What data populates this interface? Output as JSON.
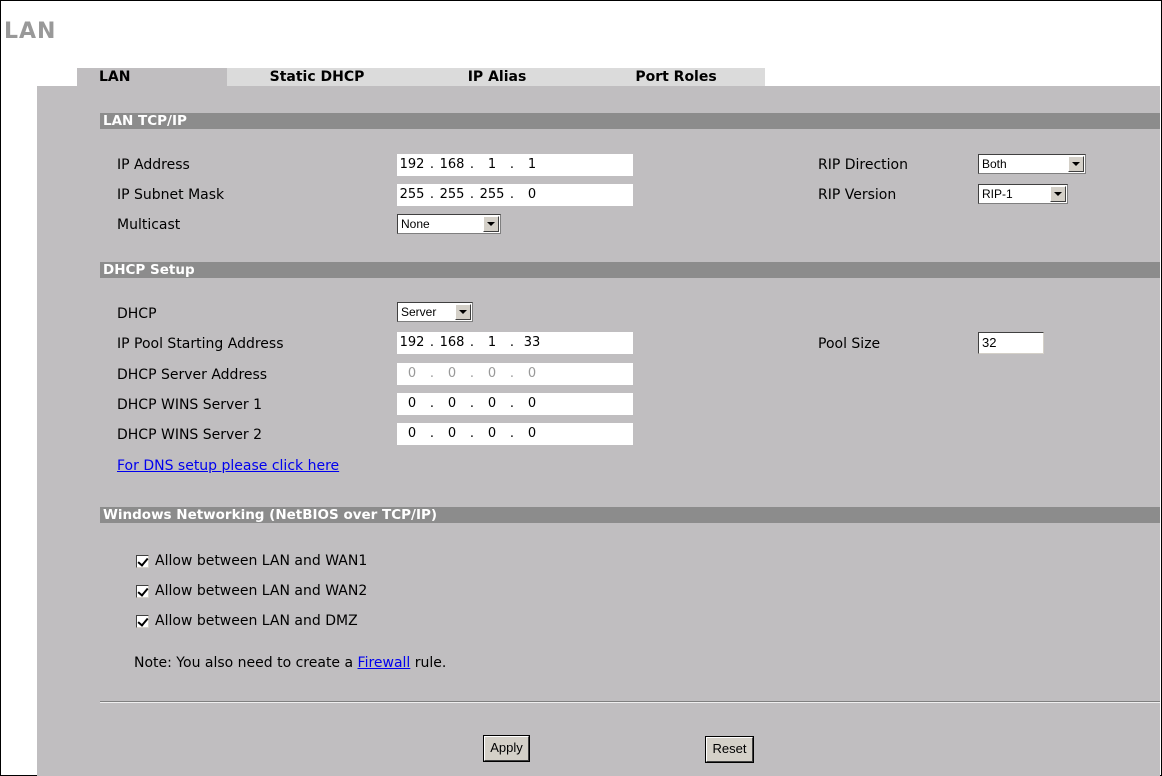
{
  "page": {
    "title": "LAN"
  },
  "tabs": [
    {
      "label": "LAN",
      "active": true
    },
    {
      "label": "Static DHCP",
      "active": false
    },
    {
      "label": "IP Alias",
      "active": false
    },
    {
      "label": "Port Roles",
      "active": false
    }
  ],
  "lan_tcpip": {
    "header": "LAN TCP/IP",
    "ip_address": {
      "label": "IP Address",
      "octets": [
        "192",
        "168",
        "1",
        "1"
      ]
    },
    "subnet_mask": {
      "label": "IP Subnet Mask",
      "octets": [
        "255",
        "255",
        "255",
        "0"
      ]
    },
    "multicast": {
      "label": "Multicast",
      "value": "None"
    },
    "rip_direction": {
      "label": "RIP Direction",
      "value": "Both"
    },
    "rip_version": {
      "label": "RIP Version",
      "value": "RIP-1"
    }
  },
  "dhcp_setup": {
    "header": "DHCP Setup",
    "dhcp": {
      "label": "DHCP",
      "value": "Server"
    },
    "pool_start": {
      "label": "IP Pool Starting Address",
      "octets": [
        "192",
        "168",
        "1",
        "33"
      ]
    },
    "pool_size": {
      "label": "Pool Size",
      "value": "32"
    },
    "server_address": {
      "label": "DHCP Server Address",
      "octets": [
        "0",
        "0",
        "0",
        "0"
      ]
    },
    "wins1": {
      "label": "DHCP WINS Server 1",
      "octets": [
        "0",
        "0",
        "0",
        "0"
      ]
    },
    "wins2": {
      "label": "DHCP WINS Server 2",
      "octets": [
        "0",
        "0",
        "0",
        "0"
      ]
    },
    "dns_link": "For DNS setup please click here"
  },
  "netbios": {
    "header": "Windows Networking (NetBIOS over TCP/IP)",
    "items": [
      {
        "label": "Allow between LAN and WAN1",
        "checked": true
      },
      {
        "label": "Allow between LAN and WAN2",
        "checked": true
      },
      {
        "label": "Allow between LAN and DMZ",
        "checked": true
      }
    ],
    "note_prefix": "Note: You also need to create a ",
    "note_link": "Firewall",
    "note_suffix": " rule."
  },
  "buttons": {
    "apply": "Apply",
    "reset": "Reset"
  }
}
